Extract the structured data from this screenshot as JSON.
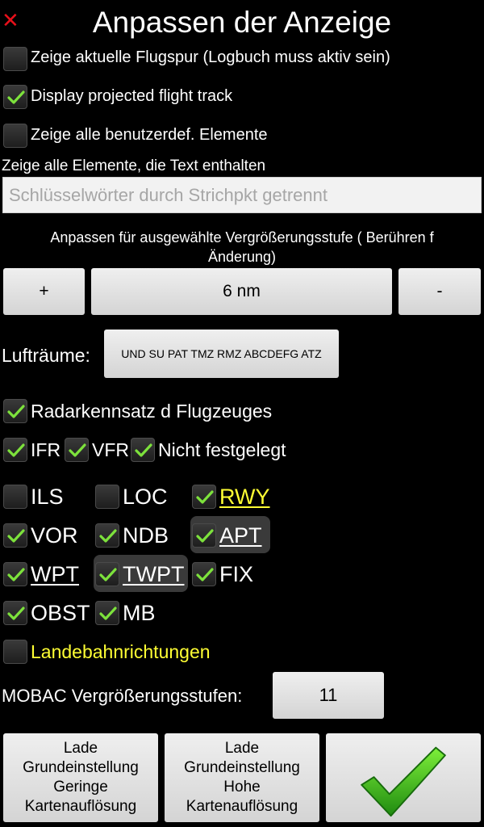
{
  "header": {
    "close_glyph": "✕",
    "title": "Anpassen der Anzeige"
  },
  "options": {
    "flight_track_actual": {
      "label": "Zeige aktuelle Flugspur (Logbuch muss aktiv sein)",
      "checked": false
    },
    "projected_track": {
      "label": "Display projected flight track",
      "checked": true
    },
    "user_elements": {
      "label": "Zeige alle benutzerdef. Elemente",
      "checked": false
    }
  },
  "text_filter": {
    "label": "Zeige alle Elemente, die Text enthalten",
    "placeholder": "Schlüsselwörter durch Strichpkt getrennt",
    "value": ""
  },
  "zoom": {
    "info": "Anpassen für ausgewählte Vergrößerungsstufe ( Berühren f Änderung)",
    "plus_label": "+",
    "value": "6 nm",
    "minus_label": "-"
  },
  "airspace": {
    "label": "Lufträume:",
    "button_label": "UND SU PAT TMZ RMZ ABCDEFG ATZ"
  },
  "radar": {
    "label": "Radarkennsatz d Flugzeuges",
    "checked": true
  },
  "flight_rules": [
    {
      "label": "IFR",
      "checked": true
    },
    {
      "label": "VFR",
      "checked": true
    },
    {
      "label": "Nicht festgelegt",
      "checked": true
    }
  ],
  "layers": {
    "ils": {
      "label": "ILS",
      "checked": false
    },
    "loc": {
      "label": "LOC",
      "checked": false
    },
    "rwy": {
      "label": "RWY",
      "checked": true
    },
    "vor": {
      "label": "VOR",
      "checked": true
    },
    "ndb": {
      "label": "NDB",
      "checked": true
    },
    "apt": {
      "label": "APT",
      "checked": true
    },
    "wpt": {
      "label": "WPT",
      "checked": true
    },
    "twpt": {
      "label": "TWPT",
      "checked": true
    },
    "fix": {
      "label": "FIX",
      "checked": true
    },
    "obst": {
      "label": "OBST",
      "checked": true
    },
    "mb": {
      "label": "MB",
      "checked": true
    }
  },
  "runway_directions": {
    "label": "Landebahnrichtungen",
    "checked": false
  },
  "mobac": {
    "label": "MOBAC Vergrößerungsstufen:",
    "value": "11"
  },
  "footer": {
    "low_res_label": "Lade Grundeinstellung Geringe Kartenauflösung",
    "high_res_label": "Lade Grundeinstellung Hohe Kartenauflösung",
    "confirm_icon": "checkmark-icon"
  },
  "colors": {
    "check_green": "#7de23c",
    "highlight_yellow": "#ffff33",
    "close_red": "#e8101a"
  }
}
